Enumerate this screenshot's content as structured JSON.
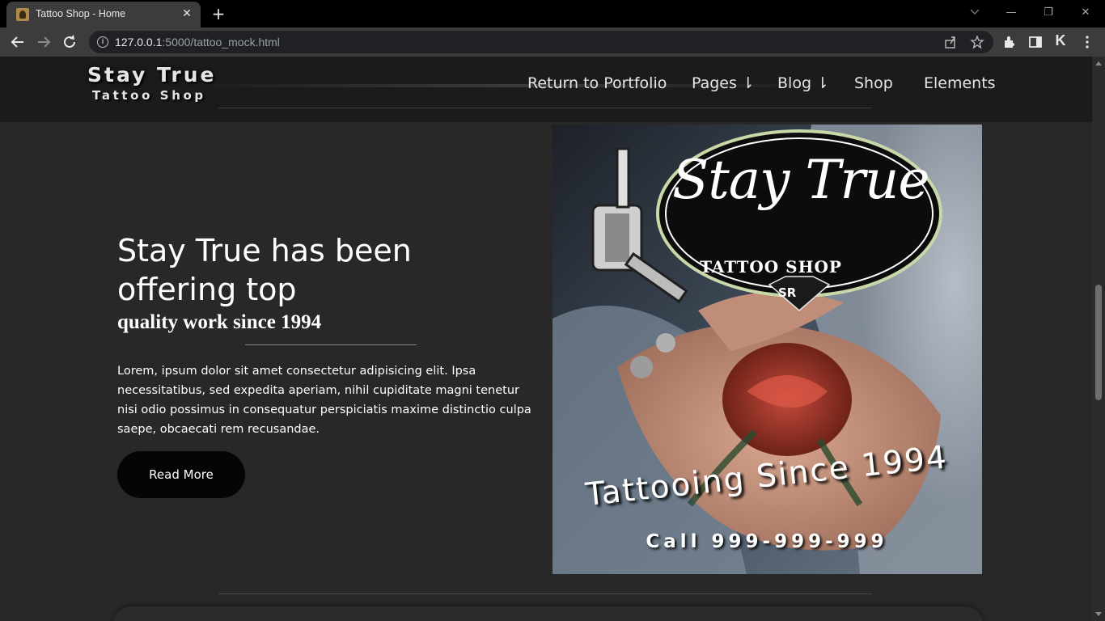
{
  "browser": {
    "tab_title": "Tattoo Shop - Home",
    "tab_close_glyph": "✕",
    "new_tab_glyph": "+",
    "url_host": "127.0.0.1",
    "url_path": ":5000/tattoo_mock.html",
    "icons": [
      "back-icon",
      "forward-icon",
      "reload-icon",
      "info-icon",
      "share-icon",
      "bookmark-star-icon",
      "extensions-icon",
      "side-panel-icon",
      "profile-icon",
      "menu-icon"
    ],
    "window_controls": {
      "minimize": "—",
      "restore": "❐",
      "close": "✕"
    }
  },
  "site": {
    "brand_top": "Stay True",
    "brand_bottom": "Tattoo Shop",
    "nav": [
      {
        "label": "Return to Portfolio"
      },
      {
        "label": "Pages ⇂"
      },
      {
        "label": "Blog ⇂"
      },
      {
        "label": "Shop"
      },
      {
        "label": "Elements"
      }
    ]
  },
  "hero": {
    "title": "Stay True has been offering top",
    "subtitle": "quality work since 1994",
    "body": "Lorem, ipsum dolor sit amet consectetur adipisicing elit. Ipsa necessitatibus, sed expedita aperiam, nihil cupiditate magni tenetur nisi odio possimus in consequatur perspiciatis maxime distinctio culpa saepe, obcaecati rem recusandae.",
    "button_label": "Read More"
  },
  "poster": {
    "logo_script": "Stay True",
    "logo_sub": "TATTOO SHOP",
    "logo_badge": "SR",
    "tagline": "Tattooing Since 1994",
    "phone": "Call 999-999-999"
  },
  "colors": {
    "page_bg": "#282828",
    "header_bg": "#1b1b1b",
    "button_bg": "#050505",
    "text": "#ffffff"
  }
}
